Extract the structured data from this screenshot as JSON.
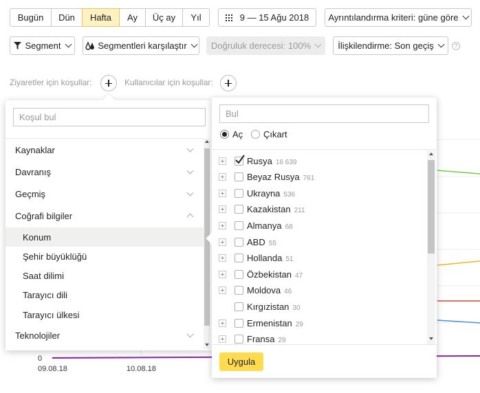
{
  "toolbar": {
    "periods": [
      "Bugün",
      "Dün",
      "Hafta",
      "Ay",
      "Üç ay",
      "Yıl"
    ],
    "active_period": "Hafta",
    "date_range": "9 — 15 Ağu 2018",
    "detail_label": "Ayrıntılandırma kriteri: güne göre",
    "segment_label": "Segment",
    "compare_label": "Segmentleri karşılaştır",
    "accuracy_label": "Doğruluk derecesi: 100%",
    "attribution_label": "İlişkilendirme: Son geçiş",
    "help_symbol": "?"
  },
  "conditions": {
    "visits_label": "Ziyaretler için koşullar:",
    "users_label": "Kullanıcılar için koşullar:"
  },
  "left_panel": {
    "search_placeholder": "Koşul bul",
    "categories": [
      {
        "label": "Kaynaklar",
        "expanded": false
      },
      {
        "label": "Davranış",
        "expanded": false
      },
      {
        "label": "Geçmiş",
        "expanded": false
      },
      {
        "label": "Coğrafi bilgiler",
        "expanded": true
      }
    ],
    "sub_items": [
      "Konum",
      "Şehir büyüklüğü",
      "Saat dilimi",
      "Tarayıcı dili",
      "Tarayıcı ülkesi"
    ],
    "selected_sub_item": "Konum",
    "last_category": "Teknolojiler"
  },
  "right_panel": {
    "search_placeholder": "Bul",
    "radio_open": "Aç",
    "radio_exclude": "Çıkart",
    "countries": [
      {
        "name": "Rusya",
        "count": "16 639",
        "checked": true,
        "expandable": true
      },
      {
        "name": "Beyaz Rusya",
        "count": "761",
        "checked": false,
        "expandable": true
      },
      {
        "name": "Ukrayna",
        "count": "536",
        "checked": false,
        "expandable": true
      },
      {
        "name": "Kazakistan",
        "count": "211",
        "checked": false,
        "expandable": true
      },
      {
        "name": "Almanya",
        "count": "68",
        "checked": false,
        "expandable": true
      },
      {
        "name": "ABD",
        "count": "55",
        "checked": false,
        "expandable": true
      },
      {
        "name": "Hollanda",
        "count": "51",
        "checked": false,
        "expandable": true
      },
      {
        "name": "Özbekistan",
        "count": "47",
        "checked": false,
        "expandable": true
      },
      {
        "name": "Moldova",
        "count": "46",
        "checked": false,
        "expandable": true
      },
      {
        "name": "Kırgızistan",
        "count": "30",
        "checked": false,
        "expandable": false
      },
      {
        "name": "Ermenistan",
        "count": "29",
        "checked": false,
        "expandable": true
      },
      {
        "name": "Fransa",
        "count": "29",
        "checked": false,
        "expandable": true
      }
    ],
    "apply_label": "Uygula"
  },
  "chart": {
    "y_zero": "0",
    "x_labels": [
      "09.08.18",
      "10.08.18"
    ],
    "line_colors": [
      "#7ac943",
      "#f2b51f",
      "#e8442f",
      "#4a90e2",
      "#8e24aa"
    ]
  },
  "colors": {
    "accent_yellow": "#ffdb4d",
    "active_period_bg": "#fff2c2"
  }
}
